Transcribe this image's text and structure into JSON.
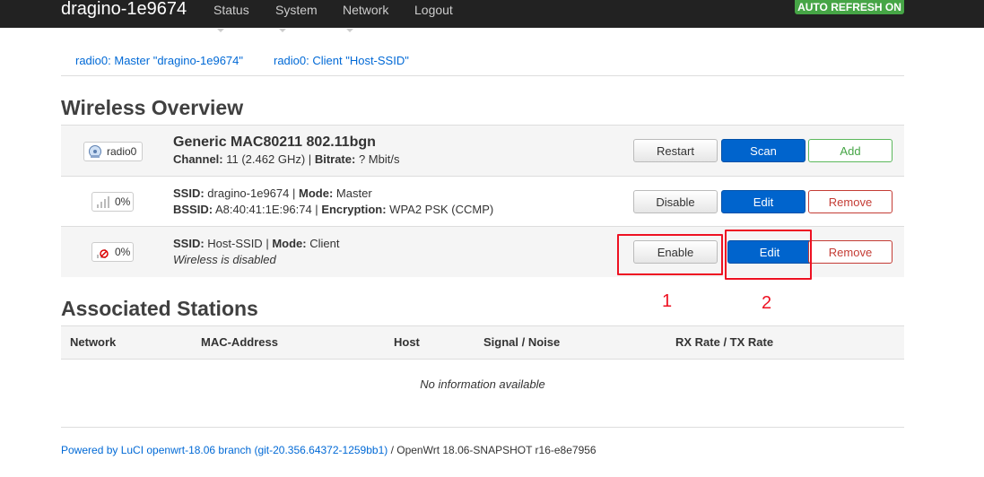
{
  "header": {
    "brand": "dragino-1e9674",
    "menu": [
      {
        "label": "Status",
        "dropdown": true
      },
      {
        "label": "System",
        "dropdown": true
      },
      {
        "label": "Network",
        "dropdown": true
      },
      {
        "label": "Logout",
        "dropdown": false
      }
    ],
    "autorefresh": "AUTO REFRESH ON"
  },
  "tabs": [
    "radio0: Master \"dragino-1e9674\"",
    "radio0: Client \"Host-SSID\""
  ],
  "overview": {
    "title": "Wireless Overview",
    "device": {
      "badge": "radio0",
      "name": "Generic MAC80211 802.11bgn",
      "channel_label": "Channel:",
      "channel_value": "11 (2.462 GHz)",
      "sep": "|",
      "bitrate_label": "Bitrate:",
      "bitrate_value": "? Mbit/s",
      "buttons": {
        "restart": "Restart",
        "scan": "Scan",
        "add": "Add"
      }
    },
    "networks": [
      {
        "signal": "0%",
        "ssid_label": "SSID:",
        "ssid": "dragino-1e9674",
        "mode_label": "Mode:",
        "mode": "Master",
        "bssid_label": "BSSID:",
        "bssid": "A8:40:41:1E:96:74",
        "enc_label": "Encryption:",
        "enc": "WPA2 PSK (CCMP)",
        "buttons": {
          "toggle": "Disable",
          "edit": "Edit",
          "remove": "Remove"
        }
      },
      {
        "signal": "0%",
        "ssid_label": "SSID:",
        "ssid": "Host-SSID",
        "mode_label": "Mode:",
        "mode": "Client",
        "status": "Wireless is disabled",
        "buttons": {
          "toggle": "Enable",
          "edit": "Edit",
          "remove": "Remove"
        }
      }
    ]
  },
  "annotations": [
    "1",
    "2"
  ],
  "stations": {
    "title": "Associated Stations",
    "columns": [
      "Network",
      "MAC-Address",
      "Host",
      "Signal / Noise",
      "RX Rate / TX Rate"
    ],
    "empty": "No information available"
  },
  "footer": {
    "link": "Powered by LuCI openwrt-18.06 branch (git-20.356.64372-1259bb1)",
    "rest": " / OpenWrt 18.06-SNAPSHOT r16-e8e7956"
  },
  "colors": {
    "accent": "#0064cd",
    "autorefresh": "#46a546",
    "annotation": "#ee1122"
  }
}
